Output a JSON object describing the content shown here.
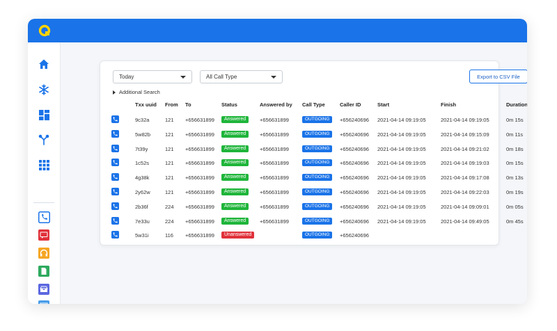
{
  "colors": {
    "topbar": "#1a73e8",
    "logo": "#ffd400",
    "answered": "#1fb53a",
    "unanswered": "#e0323b",
    "outgoing": "#1a73e8",
    "accent": "#1a73e8"
  },
  "sidebar": {
    "items": [
      {
        "name": "home-icon",
        "color": "#1a73e8"
      },
      {
        "name": "snowflake-icon",
        "color": "#1a73e8"
      },
      {
        "name": "dashboard-icon",
        "color": "#1a73e8"
      },
      {
        "name": "branch-icon",
        "color": "#1a73e8"
      },
      {
        "name": "grid-icon",
        "color": "#1a73e8"
      },
      {
        "name": "phone-icon",
        "color": "#1a73e8"
      },
      {
        "name": "sms-icon",
        "color": "#e0323b"
      },
      {
        "name": "headset-icon",
        "color": "#f5a623"
      },
      {
        "name": "document-icon",
        "color": "#2eaa5e"
      },
      {
        "name": "inbox-icon",
        "color": "#5b67e0"
      },
      {
        "name": "image-icon",
        "color": "#4a9ce8"
      }
    ]
  },
  "filters": {
    "date": "Today",
    "call_type": "All Call Type"
  },
  "export_label": "Export to CSV File",
  "advanced_search_label": "Additional Search",
  "columns": [
    "Txx uuid",
    "From",
    "To",
    "Status",
    "Answered by",
    "Call Type",
    "Caller ID",
    "Start",
    "Finish",
    "Duration"
  ],
  "rows": [
    {
      "uuid": "9c32a",
      "from": "121",
      "to": "+656631899",
      "status": "Answered",
      "answered_by": "+656631899",
      "call_type": "OUTGOING",
      "caller_id": "+656240696",
      "start": "2021-04-14  09:19:05",
      "finish": "2021-04-14  09:19:05",
      "duration": "0m 15s"
    },
    {
      "uuid": "5w82b",
      "from": "121",
      "to": "+656631899",
      "status": "Answered",
      "answered_by": "+656631899",
      "call_type": "OUTGOING",
      "caller_id": "+656240696",
      "start": "2021-04-14  09:19:05",
      "finish": "2021-04-14  09:15:09",
      "duration": "0m 11s"
    },
    {
      "uuid": "7t39y",
      "from": "121",
      "to": "+656631899",
      "status": "Answered",
      "answered_by": "+656631899",
      "call_type": "OUTGOING",
      "caller_id": "+656240696",
      "start": "2021-04-14  09:19:05",
      "finish": "2021-04-14  09:21:02",
      "duration": "0m 18s"
    },
    {
      "uuid": "1c52s",
      "from": "121",
      "to": "+656631899",
      "status": "Answered",
      "answered_by": "+656631899",
      "call_type": "OUTGOING",
      "caller_id": "+656240696",
      "start": "2021-04-14  09:19:05",
      "finish": "2021-04-14  09:19:03",
      "duration": "0m 15s"
    },
    {
      "uuid": "4g38k",
      "from": "121",
      "to": "+656631899",
      "status": "Answered",
      "answered_by": "+656631899",
      "call_type": "OUTGOING",
      "caller_id": "+656240696",
      "start": "2021-04-14  09:19:05",
      "finish": "2021-04-14  09:17:08",
      "duration": "0m 13s"
    },
    {
      "uuid": "2y62w",
      "from": "121",
      "to": "+656631899",
      "status": "Answered",
      "answered_by": "+656631899",
      "call_type": "OUTGOING",
      "caller_id": "+656240696",
      "start": "2021-04-14  09:19:05",
      "finish": "2021-04-14  09:22:03",
      "duration": "0m 19s"
    },
    {
      "uuid": "2b36f",
      "from": "224",
      "to": "+656631899",
      "status": "Answered",
      "answered_by": "+656631899",
      "call_type": "OUTGOING",
      "caller_id": "+656240696",
      "start": "2021-04-14  09:19:05",
      "finish": "2021-04-14  09:09:01",
      "duration": "0m 05s"
    },
    {
      "uuid": "7e33u",
      "from": "224",
      "to": "+656631899",
      "status": "Answered",
      "answered_by": "+656631899",
      "call_type": "OUTGOING",
      "caller_id": "+656240696",
      "start": "2021-04-14  09:19:05",
      "finish": "2021-04-14  09:49:05",
      "duration": "0m 45s"
    },
    {
      "uuid": "5w31i",
      "from": "116",
      "to": "+656631899",
      "status": "Unanswered",
      "answered_by": "",
      "call_type": "OUTGOING",
      "caller_id": "+656240696",
      "start": "",
      "finish": "",
      "duration": ""
    }
  ]
}
